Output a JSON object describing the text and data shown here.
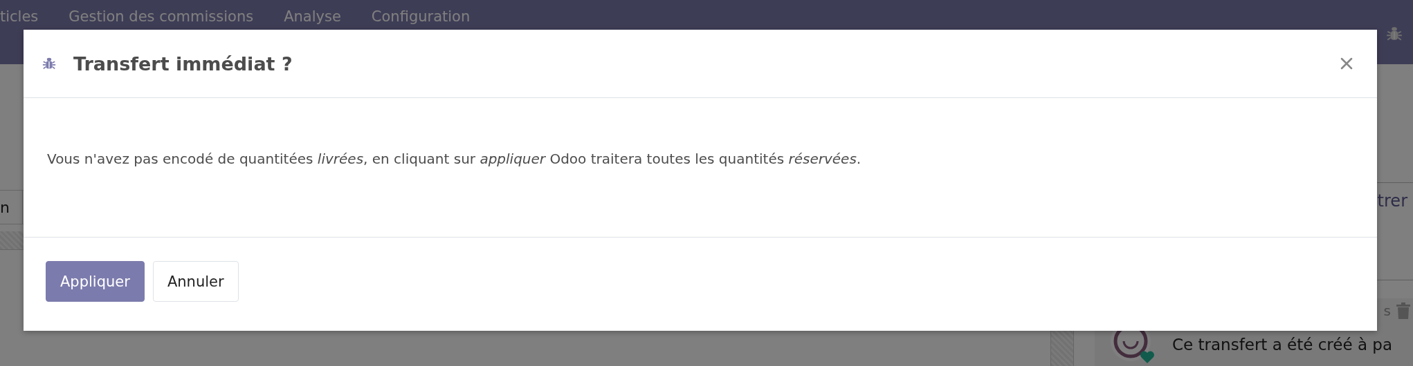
{
  "navbar": {
    "menu_items": [
      "ticles",
      "Gestion des commissions",
      "Analyse",
      "Configuration"
    ]
  },
  "form": {
    "field_fragment": "n"
  },
  "chatter": {
    "link_fragment": "trer",
    "message": {
      "meta_fragment": "s",
      "body": "Ce transfert a été créé à pa"
    }
  },
  "dialog": {
    "title": "Transfert immédiat ?",
    "message": "Vous n'avez pas encodé de quantitées *livrées*, en cliquant sur *appliquer* Odoo traitera toutes les quantités *réservées*.",
    "buttons": [
      {
        "label": "Appliquer",
        "kind": "primary"
      },
      {
        "label": "Annuler",
        "kind": "secondary"
      }
    ]
  }
}
